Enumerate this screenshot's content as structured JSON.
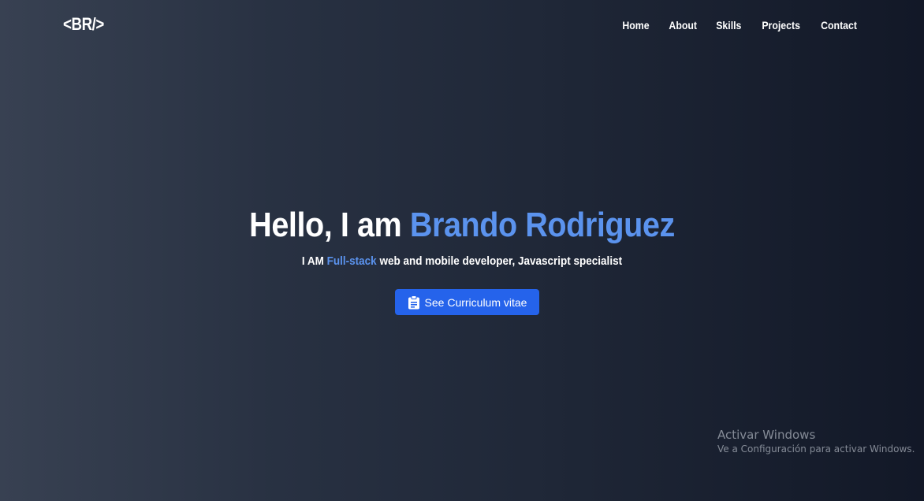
{
  "nav": {
    "logo": "<BR/>",
    "links": [
      "Home",
      "About",
      "Skills",
      "Projects",
      "Contact"
    ]
  },
  "hero": {
    "greeting": "Hello, I am ",
    "name": "Brando Rodriguez",
    "sub_prefix": "I AM ",
    "sub_accent": "Full-stack",
    "sub_suffix": " web and mobile developer, Javascript specialist",
    "cv_button": "See Curriculum vitae",
    "cv_icon": "clipboard-icon"
  },
  "watermark": {
    "title": "Activar Windows",
    "subtitle": "Ve a Configuración para activar Windows."
  },
  "colors": {
    "accent": "#5b93ee",
    "button": "#2563eb",
    "background_left": "#384152",
    "background_right": "#121827"
  }
}
